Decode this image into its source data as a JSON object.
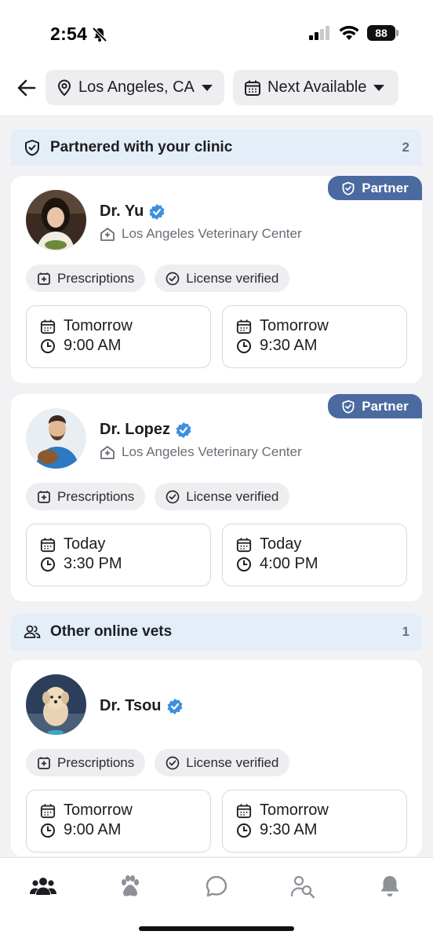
{
  "status_bar": {
    "time": "2:54",
    "battery": "88"
  },
  "header": {
    "location": "Los Angeles, CA",
    "availability": "Next Available"
  },
  "sections": [
    {
      "title": "Partnered with your clinic",
      "count": "2"
    },
    {
      "title": "Other online vets",
      "count": "1"
    }
  ],
  "partner_label": "Partner",
  "tags": {
    "prescriptions": "Prescriptions",
    "license": "License verified"
  },
  "vets": [
    {
      "name": "Dr. Yu",
      "clinic": "Los Angeles Veterinary Center",
      "slots": [
        {
          "day": "Tomorrow",
          "time": "9:00 AM"
        },
        {
          "day": "Tomorrow",
          "time": "9:30 AM"
        }
      ]
    },
    {
      "name": "Dr. Lopez",
      "clinic": "Los Angeles Veterinary Center",
      "slots": [
        {
          "day": "Today",
          "time": "3:30 PM"
        },
        {
          "day": "Today",
          "time": "4:00 PM"
        }
      ]
    },
    {
      "name": "Dr. Tsou",
      "slots": [
        {
          "day": "Tomorrow",
          "time": "9:00 AM"
        },
        {
          "day": "Tomorrow",
          "time": "9:30 AM"
        }
      ]
    }
  ],
  "bottom_nav": [
    "people-icon",
    "paw-icon",
    "chat-icon",
    "find-vet-icon",
    "bell-icon"
  ],
  "colors": {
    "accent": "#4b6aa0",
    "verified": "#3d8fe0",
    "section_bg": "#e3eef9"
  }
}
